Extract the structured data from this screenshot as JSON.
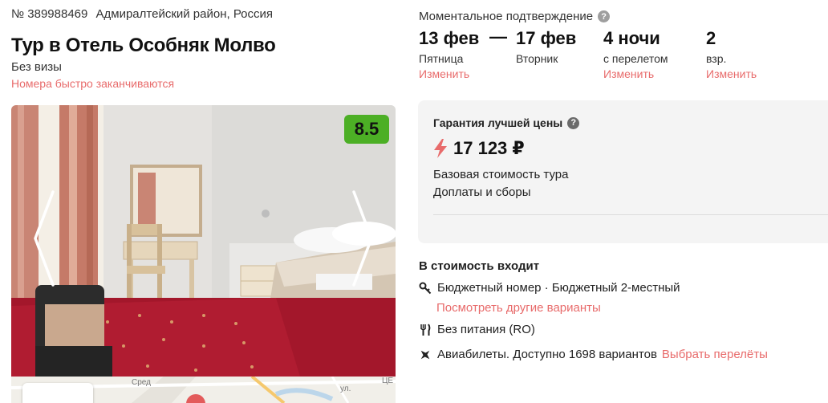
{
  "tour": {
    "id_label": "№ 389988469",
    "region": "Адмиралтейский район, Россия",
    "title": "Тур в Отель Особняк Молво",
    "visa": "Без визы",
    "hurry": "Номера быстро заканчиваются",
    "rating": "8.5"
  },
  "booking": {
    "instant": "Моментальное подтверждение",
    "date_from": {
      "value": "13 фев",
      "day": "Пятница",
      "change": "Изменить"
    },
    "dash": "—",
    "date_to": {
      "value": "17 фев",
      "day": "Вторник"
    },
    "nights": {
      "value": "4 ночи",
      "sub": "с перелетом",
      "change": "Изменить"
    },
    "adults": {
      "value": "2",
      "sub": "взр.",
      "change": "Изменить"
    }
  },
  "price_card": {
    "guarantee": "Гарантия лучшей цены",
    "price": "17 123 ₽",
    "base": "Базовая стоимость тура",
    "fees": "Доплаты и сборы"
  },
  "included": {
    "title": "В стоимость входит",
    "room": "Бюджетный номер · Бюджетный 2-местный",
    "room_link": "Посмотреть другие варианты",
    "meal": "Без питания (RO)",
    "flights": "Авиабилеты. Доступно 1698 вариантов",
    "flights_link": "Выбрать перелёты"
  },
  "map": {
    "label_1": "Сред",
    "label_2": "ул.",
    "label_3": "ЦЕ"
  },
  "colors": {
    "accent": "#e86b6b",
    "rating": "#4caf25",
    "card_bg": "#f4f4f4"
  },
  "icons": [
    "question-icon",
    "bolt-icon",
    "key-icon",
    "fork-knife-icon",
    "plane-icon",
    "chevron-left-icon",
    "chevron-right-icon"
  ]
}
